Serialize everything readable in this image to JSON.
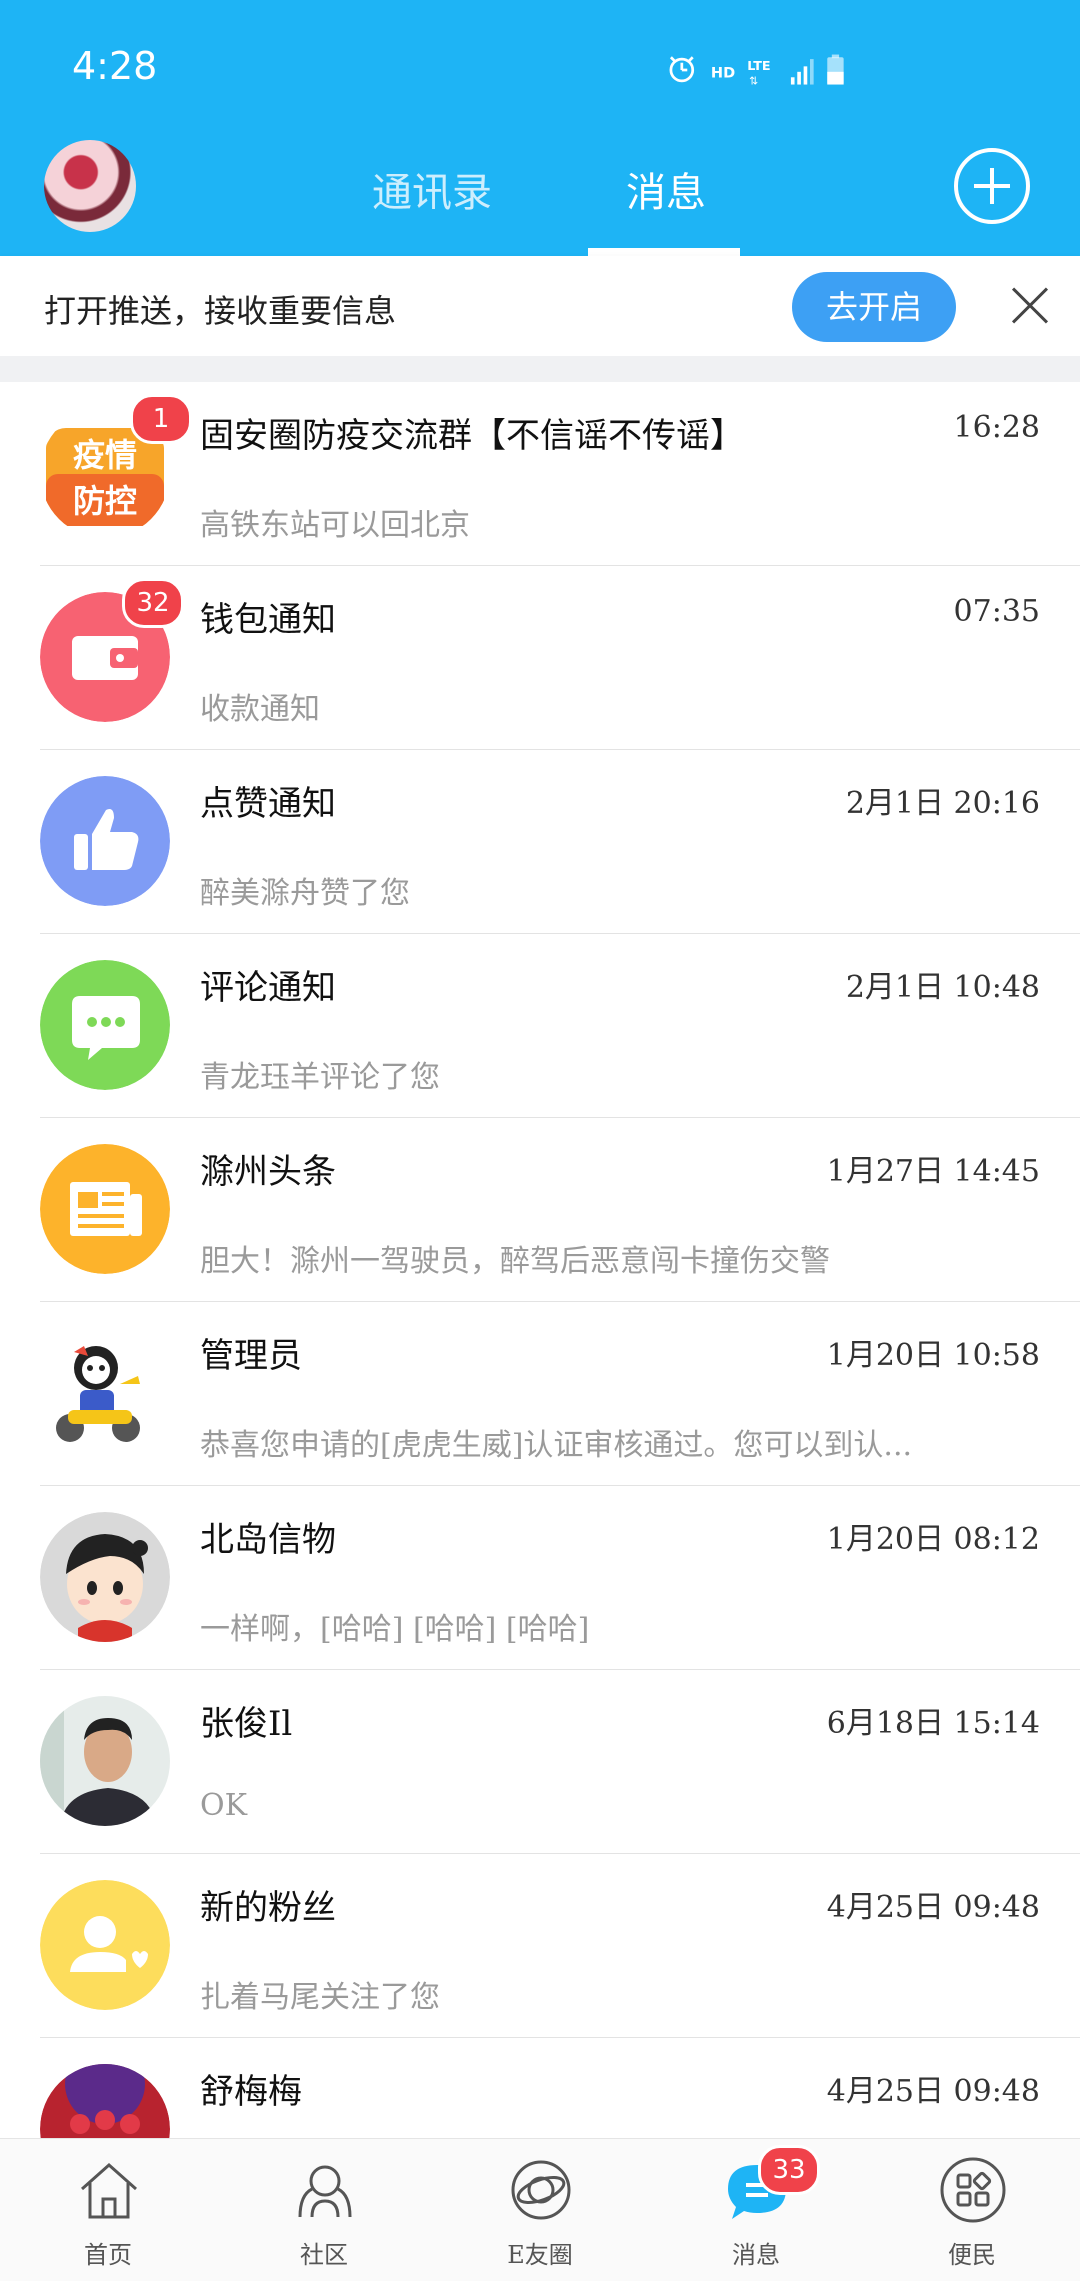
{
  "status": {
    "time": "4:28",
    "hd": "HD",
    "lte": "LTE"
  },
  "header": {
    "tabs": [
      "通讯录",
      "消息"
    ],
    "active_tab": "消息"
  },
  "push_banner": {
    "text": "打开推送，接收重要信息",
    "button": "去开启"
  },
  "conversations": [
    {
      "title": "固安圈防疫交流群【不信谣不传谣】",
      "preview": "高铁东站可以回北京",
      "time": "16:28",
      "badge": "1",
      "avatar": "epidemic-control"
    },
    {
      "title": "钱包通知",
      "preview": "收款通知",
      "time": "07:35",
      "badge": "32",
      "avatar": "wallet"
    },
    {
      "title": "点赞通知",
      "preview": "醉美滁舟赞了您",
      "time": "2月1日  20:16",
      "avatar": "thumbs-up"
    },
    {
      "title": "评论通知",
      "preview": "青龙珏羊评论了您",
      "time": "2月1日  10:48",
      "avatar": "comment"
    },
    {
      "title": "滁州头条",
      "preview": "胆大！滁州一驾驶员，醉驾后恶意闯卡撞伤交警",
      "time": "1月27日  14:45",
      "avatar": "news"
    },
    {
      "title": "管理员",
      "preview": "恭喜您申请的[虎虎生威]认证审核通过。您可以到认...",
      "time": "1月20日  10:58",
      "avatar": "admin-tiger"
    },
    {
      "title": "北岛信物",
      "preview": "一样啊，[哈哈] [哈哈] [哈哈]",
      "time": "1月20日  08:12",
      "avatar": "cartoon-boy"
    },
    {
      "title": "张俊Il",
      "preview": "OK",
      "time": "6月18日  15:14",
      "avatar": "photo-man"
    },
    {
      "title": "新的粉丝",
      "preview": "扎着马尾关注了您",
      "time": "4月25日  09:48",
      "avatar": "new-fans"
    },
    {
      "title": "舒梅梅",
      "preview": "",
      "time": "4月25日  09:48",
      "avatar": "flowers"
    }
  ],
  "bottom_nav": {
    "items": [
      "首页",
      "社区",
      "E友圈",
      "消息",
      "便民"
    ],
    "active": "消息",
    "message_badge": "33"
  },
  "colors": {
    "header": "#1EB4F5",
    "badge": "#F0424A",
    "button": "#3DA0F4"
  }
}
